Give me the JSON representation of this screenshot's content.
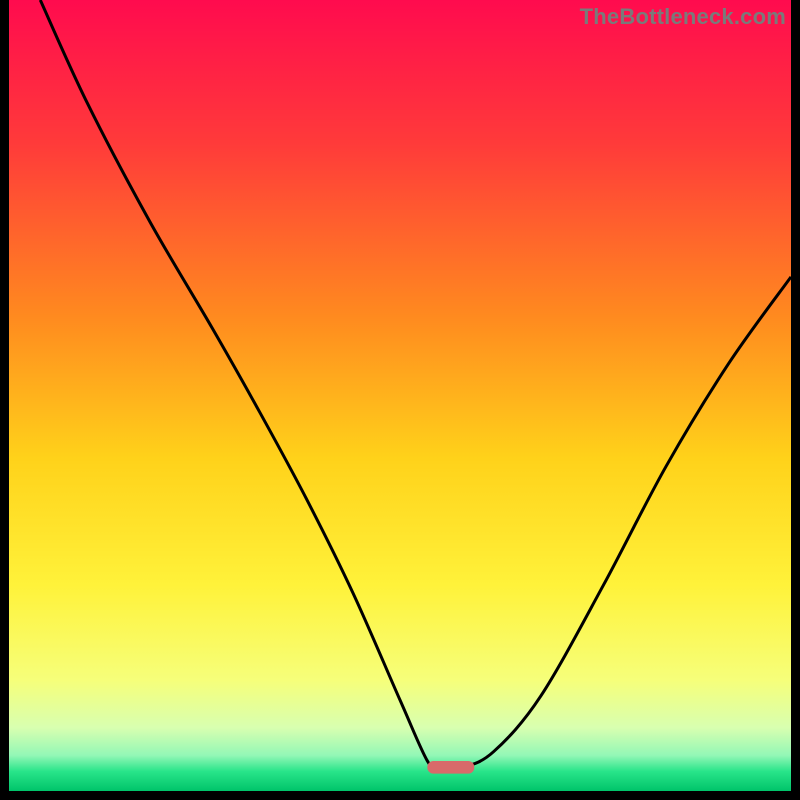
{
  "watermark": "TheBottleneck.com",
  "chart_data": {
    "type": "line",
    "title": "",
    "xlabel": "",
    "ylabel": "",
    "xlim": [
      0,
      100
    ],
    "ylim": [
      0,
      100
    ],
    "grid": false,
    "legend": false,
    "background_gradient": {
      "stops": [
        {
          "offset": 0.0,
          "color": "#ff0b4e"
        },
        {
          "offset": 0.18,
          "color": "#ff3a3a"
        },
        {
          "offset": 0.4,
          "color": "#ff8a1f"
        },
        {
          "offset": 0.58,
          "color": "#ffd21a"
        },
        {
          "offset": 0.74,
          "color": "#fff23a"
        },
        {
          "offset": 0.86,
          "color": "#f6ff7a"
        },
        {
          "offset": 0.92,
          "color": "#d8ffb0"
        },
        {
          "offset": 0.955,
          "color": "#93f7b6"
        },
        {
          "offset": 0.975,
          "color": "#29e58a"
        },
        {
          "offset": 1.0,
          "color": "#00c46a"
        }
      ]
    },
    "series": [
      {
        "name": "bottleneck-curve",
        "color": "#000000",
        "x": [
          4,
          10,
          18,
          26,
          32,
          38,
          44,
          50,
          53.5,
          55,
          58,
          62,
          68,
          76,
          84,
          92,
          100
        ],
        "y": [
          100,
          87,
          72,
          58.5,
          48,
          37,
          25,
          11.5,
          3.8,
          3,
          3,
          5,
          12,
          26,
          41,
          54,
          65
        ]
      }
    ],
    "marker": {
      "name": "optimal-range",
      "shape": "rounded-rect",
      "color": "#d86a6a",
      "x_center": 56.5,
      "y_center": 3.0,
      "width_x": 6.0,
      "height_y": 1.6
    }
  }
}
